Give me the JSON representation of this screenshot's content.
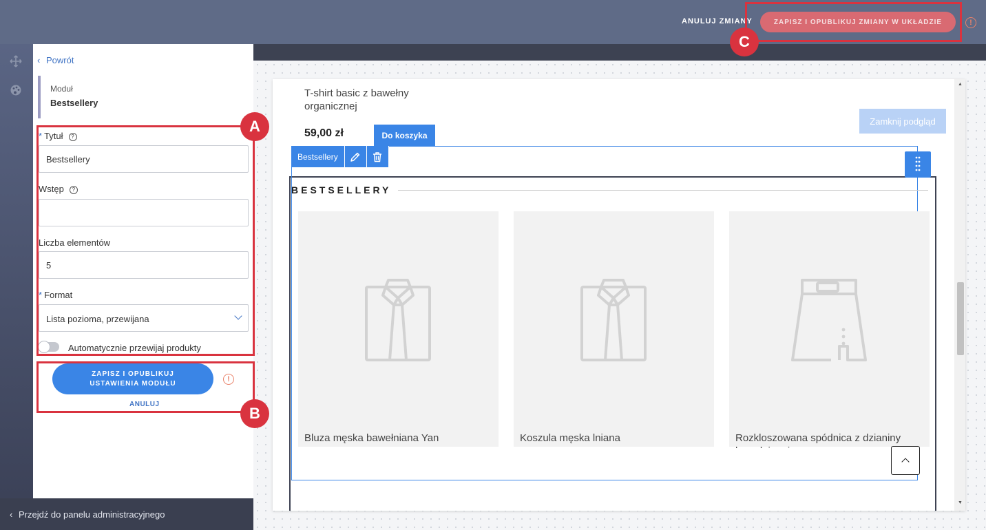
{
  "topbar": {
    "cancel_label": "ANULUJ ZMIANY",
    "publish_label": "ZAPISZ I OPUBLIKUJ ZMIANY W UKŁADZIE",
    "warning_glyph": "!"
  },
  "panel": {
    "back_label": "Powrót",
    "module_label": "Moduł",
    "module_name": "Bestsellery",
    "fields": {
      "title": {
        "label": "Tytuł",
        "required": "*",
        "value": "Bestsellery"
      },
      "intro": {
        "label": "Wstęp",
        "value": ""
      },
      "count": {
        "label": "Liczba elementów",
        "value": "5"
      },
      "format": {
        "label": "Format",
        "required": "*",
        "value": "Lista pozioma, przewijana"
      }
    },
    "autoscroll_label": "Automatycznie przewijaj produkty",
    "autoscroll_on": false,
    "save_label_line1": "ZAPISZ I OPUBLIKUJ",
    "save_label_line2": "USTAWIENIA MODUŁU",
    "cancel_label": "ANULUJ"
  },
  "admin_link": "Przejdź do panelu administracyjnego",
  "preview": {
    "product_title": "T-shirt basic z bawełny organicznej",
    "product_price": "59,00 zł",
    "cart_label": "Do koszyka",
    "close_preview_label": "Zamknij podgląd",
    "module_tab_label": "Bestsellery",
    "section_title": "BESTSELLERY",
    "products": [
      {
        "name": "Bluza męska bawełniana Yan",
        "icon": "shirt-icon"
      },
      {
        "name": "Koszula męska lniana",
        "icon": "shirt-icon"
      },
      {
        "name": "Rozkloszowana spódnica z dzianiny bawełnianej",
        "icon": "skirt-icon"
      }
    ]
  },
  "callouts": {
    "a": "A",
    "b": "B",
    "c": "C"
  },
  "colors": {
    "accent": "#3a85e6",
    "callout": "#d9333f",
    "topbar": "#5f6b87",
    "warning": "#e9826a"
  }
}
